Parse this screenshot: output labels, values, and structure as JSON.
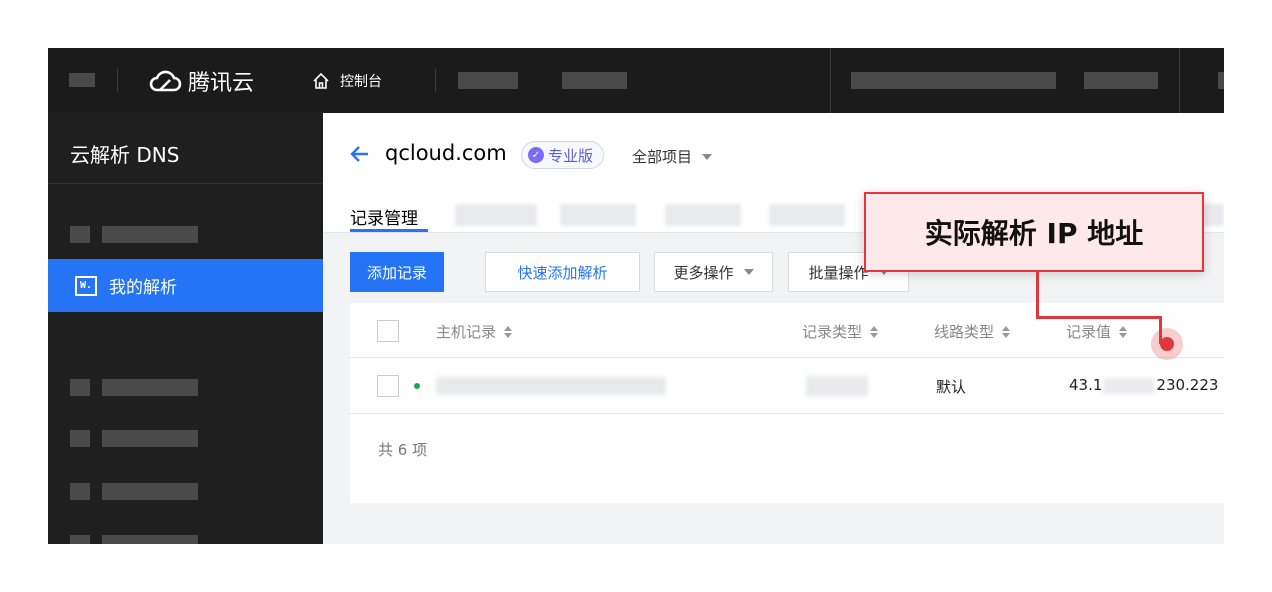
{
  "topbar": {
    "brand": "腾讯云",
    "home_label": "控制台"
  },
  "sidebar": {
    "title": "云解析 DNS",
    "active_icon_text": "W.",
    "active_label": "我的解析"
  },
  "header": {
    "back_icon": "arrow-left-icon",
    "domain": "qcloud.com",
    "edition": "专业版",
    "project": "全部项目"
  },
  "tabs": {
    "active": "记录管理"
  },
  "toolbar": {
    "add_record": "添加记录",
    "quick_add": "快速添加解析",
    "more_ops": "更多操作",
    "batch_ops": "批量操作"
  },
  "table": {
    "columns": {
      "host": "主机记录",
      "type": "记录类型",
      "line": "线路类型",
      "value": "记录值"
    },
    "row": {
      "line": "默认",
      "value_prefix": "43.1",
      "value_suffix": "230.223"
    },
    "footer": "共 6 项"
  },
  "annotation": {
    "text": "实际解析 IP 地址"
  },
  "colors": {
    "accent": "#2474f5",
    "annotation": "#e0363d",
    "sidebar_bg": "#1f1f1f",
    "topbar_bg": "#1b1b1b"
  }
}
